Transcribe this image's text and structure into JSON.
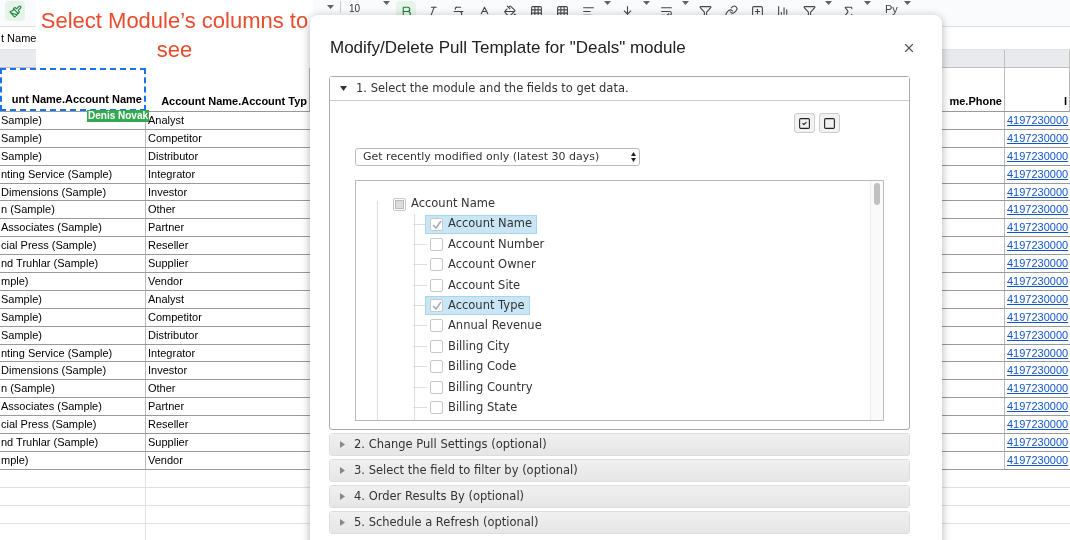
{
  "toolbar": {
    "font_size": "10",
    "input_tool": "Py"
  },
  "formula_bar_text": "t Name",
  "annotation": "Select Module’s columns to see",
  "sheet": {
    "collaborator": "Denis Novak",
    "columns": [
      {
        "header": "unt Name.Account Name",
        "selected": true
      },
      {
        "header": "Account Name.Account Typ",
        "selected": false
      },
      {
        "header": "me.Phone",
        "selected": false
      },
      {
        "header": "I",
        "selected": false
      }
    ],
    "rows": [
      {
        "column_1": "Sample)",
        "column_2": "Analyst",
        "column_4": "4197230000"
      },
      {
        "column_1": "Sample)",
        "column_2": "Competitor",
        "column_4": "4197230000"
      },
      {
        "column_1": "Sample)",
        "column_2": "Distributor",
        "column_4": "4197230000"
      },
      {
        "column_1": "nting Service (Sample)",
        "column_2": "Integrator",
        "column_4": "4197230000"
      },
      {
        "column_1": "Dimensions (Sample)",
        "column_2": "Investor",
        "column_4": "4197230000"
      },
      {
        "column_1": "n (Sample)",
        "column_2": "Other",
        "column_4": "4197230000"
      },
      {
        "column_1": "Associates (Sample)",
        "column_2": "Partner",
        "column_4": "4197230000"
      },
      {
        "column_1": "cial Press (Sample)",
        "column_2": "Reseller",
        "column_4": "4197230000"
      },
      {
        "column_1": "nd Truhlar (Sample)",
        "column_2": "Supplier",
        "column_4": "4197230000"
      },
      {
        "column_1": "mple)",
        "column_2": "Vendor",
        "column_4": "4197230000"
      },
      {
        "column_1": "Sample)",
        "column_2": "Analyst",
        "column_4": "4197230000"
      },
      {
        "column_1": "Sample)",
        "column_2": "Competitor",
        "column_4": "4197230000"
      },
      {
        "column_1": "Sample)",
        "column_2": "Distributor",
        "column_4": "4197230000"
      },
      {
        "column_1": "nting Service (Sample)",
        "column_2": "Integrator",
        "column_4": "4197230000"
      },
      {
        "column_1": "Dimensions (Sample)",
        "column_2": "Investor",
        "column_4": "4197230000"
      },
      {
        "column_1": "n (Sample)",
        "column_2": "Other",
        "column_4": "4197230000"
      },
      {
        "column_1": "Associates (Sample)",
        "column_2": "Partner",
        "column_4": "4197230000"
      },
      {
        "column_1": "cial Press (Sample)",
        "column_2": "Reseller",
        "column_4": "4197230000"
      },
      {
        "column_1": "nd Truhlar (Sample)",
        "column_2": "Supplier",
        "column_4": "4197230000"
      },
      {
        "column_1": "mple)",
        "column_2": "Vendor",
        "column_4": "4197230000"
      }
    ]
  },
  "dialog": {
    "title": "Modify/Delete Pull Template for \"Deals\" module",
    "sections": [
      {
        "label": "1. Select the module and the fields to get data.",
        "expanded": true
      },
      {
        "label": "2. Change Pull Settings (optional)",
        "expanded": false
      },
      {
        "label": "3. Select the field to filter by (optional)",
        "expanded": false
      },
      {
        "label": "4. Order Results By (optional)",
        "expanded": false
      },
      {
        "label": "5. Schedule a Refresh (optional)",
        "expanded": false
      }
    ],
    "mode_select": "Get recently modified only (latest 30 days)",
    "tree": {
      "label": "Account Name",
      "partial": true,
      "children": [
        {
          "label": "Account Name",
          "checked": true
        },
        {
          "label": "Account Number",
          "checked": false
        },
        {
          "label": "Account Owner",
          "checked": false
        },
        {
          "label": "Account Site",
          "checked": false
        },
        {
          "label": "Account Type",
          "checked": true
        },
        {
          "label": "Annual Revenue",
          "checked": false
        },
        {
          "label": "Billing City",
          "checked": false
        },
        {
          "label": "Billing Code",
          "checked": false
        },
        {
          "label": "Billing Country",
          "checked": false
        },
        {
          "label": "Billing State",
          "checked": false
        }
      ]
    }
  }
}
